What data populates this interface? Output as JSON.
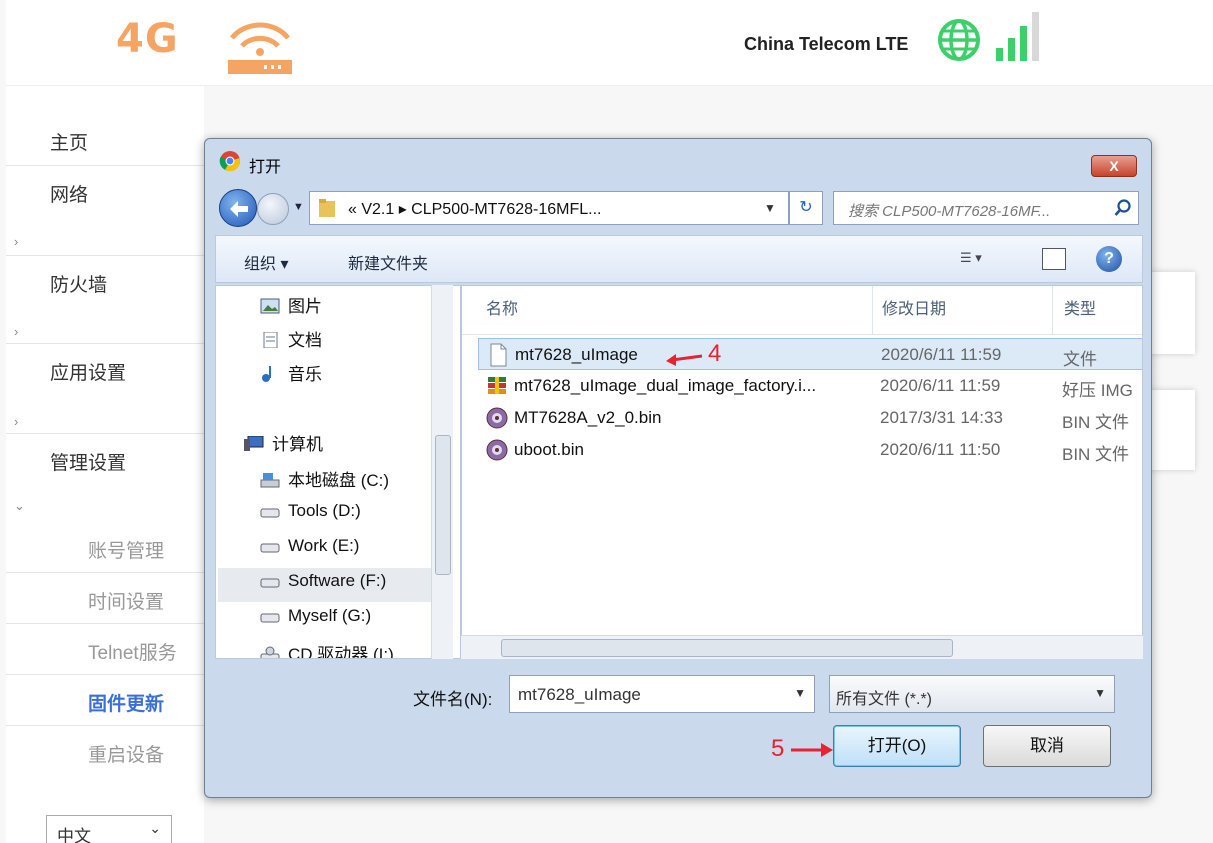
{
  "header": {
    "logo_text": "4G",
    "carrier": "China Telecom LTE",
    "router_icon": "wifi-router-icon",
    "globe_icon": "globe-icon",
    "signal_icon": "signal-bars-icon",
    "accent_color": "#f5a463"
  },
  "sidebar": {
    "items": [
      {
        "label": "主页"
      },
      {
        "label": "网络",
        "chev": "›"
      },
      {
        "label": "防火墙",
        "chev": "›"
      },
      {
        "label": "应用设置",
        "chev": "›"
      },
      {
        "label": "管理设置",
        "chev": "⌄"
      }
    ],
    "subitems": [
      {
        "label": "账号管理"
      },
      {
        "label": "时间设置"
      },
      {
        "label": "Telnet服务"
      },
      {
        "label": "固件更新",
        "active": true
      },
      {
        "label": "重启设备"
      }
    ],
    "language": "中文",
    "language_chevron": "⌄"
  },
  "dialog": {
    "title": "打开",
    "close_label": "X",
    "breadcrumb": "«  V2.1  ▸  CLP500-MT7628-16MFL...",
    "search_placeholder": "搜索 CLP500-MT7628-16MF...",
    "toolbar": {
      "organize": "组织 ▾",
      "new_folder": "新建文件夹"
    },
    "tree": [
      {
        "label": "图片",
        "icon": "pictures-icon"
      },
      {
        "label": "文档",
        "icon": "documents-icon"
      },
      {
        "label": "音乐",
        "icon": "music-icon"
      },
      {
        "label": "计算机",
        "icon": "computer-icon"
      },
      {
        "label": "本地磁盘 (C:)",
        "icon": "drive-icon"
      },
      {
        "label": "Tools (D:)",
        "icon": "drive-icon"
      },
      {
        "label": "Work (E:)",
        "icon": "drive-icon"
      },
      {
        "label": "Software (F:)",
        "icon": "drive-icon",
        "selected": true
      },
      {
        "label": "Myself (G:)",
        "icon": "drive-icon"
      },
      {
        "label": "CD 驱动器 (I:)",
        "icon": "cd-drive-icon"
      }
    ],
    "columns": {
      "name": "名称",
      "modified": "修改日期",
      "type": "类型"
    },
    "files": [
      {
        "name": "mt7628_uImage",
        "modified": "2020/6/11 11:59",
        "type": "文件",
        "icon": "file-icon",
        "selected": true
      },
      {
        "name": "mt7628_uImage_dual_image_factory.i...",
        "modified": "2020/6/11 11:59",
        "type": "好压 IMG",
        "icon": "archive-icon"
      },
      {
        "name": "MT7628A_v2_0.bin",
        "modified": "2017/3/31 14:33",
        "type": "BIN 文件",
        "icon": "bin-file-icon"
      },
      {
        "name": "uboot.bin",
        "modified": "2020/6/11 11:50",
        "type": "BIN 文件",
        "icon": "bin-file-icon"
      }
    ],
    "filename_label": "文件名(N):",
    "filename_value": "mt7628_uImage",
    "filetype_value": "所有文件 (*.*)",
    "open_button": "打开(O)",
    "cancel_button": "取消",
    "annotation_4": "4",
    "annotation_5": "5"
  }
}
